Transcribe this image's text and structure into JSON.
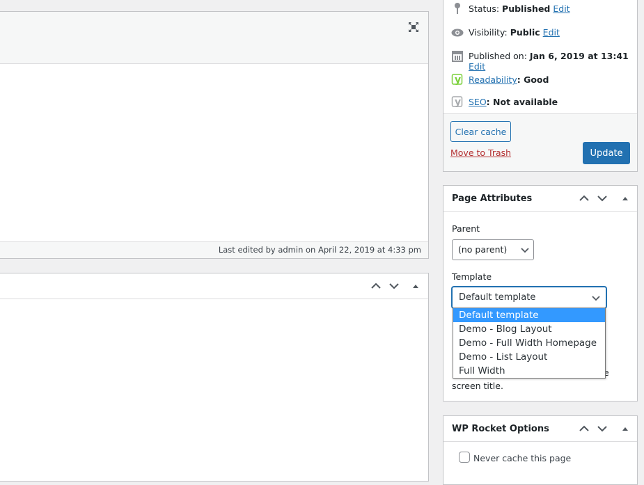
{
  "editor": {
    "last_edited": "Last edited by admin on April 22, 2019 at 4:33 pm"
  },
  "publish": {
    "status_label": "Status:",
    "status_value": "Published",
    "status_edit": "Edit",
    "visibility_label": "Visibility:",
    "visibility_value": "Public",
    "visibility_edit": "Edit",
    "published_label": "Published on:",
    "published_value": "Jan 6, 2019 at 13:41",
    "published_edit": "Edit",
    "readability_link": "Readability",
    "readability_value": ": Good",
    "seo_link": "SEO",
    "seo_value": ": Not available",
    "clear_cache": "Clear cache",
    "trash": "Move to Trash",
    "update": "Update"
  },
  "page_attributes": {
    "title": "Page Attributes",
    "parent_label": "Parent",
    "parent_value": "(no parent)",
    "template_label": "Template",
    "template_value": "Default template",
    "template_options": [
      "Default template",
      "Demo - Blog Layout",
      "Demo - Full Width Homepage",
      "Demo - List Layout",
      "Full Width"
    ],
    "help_fragment": "e",
    "help_tail": "screen title."
  },
  "wp_rocket": {
    "title": "WP Rocket Options",
    "never_cache": "Never cache this page"
  },
  "colors": {
    "primary": "#2271b1",
    "trash": "#b32d2e",
    "yoast_good": "#7ad03a",
    "selected_option": "#3399ff"
  }
}
